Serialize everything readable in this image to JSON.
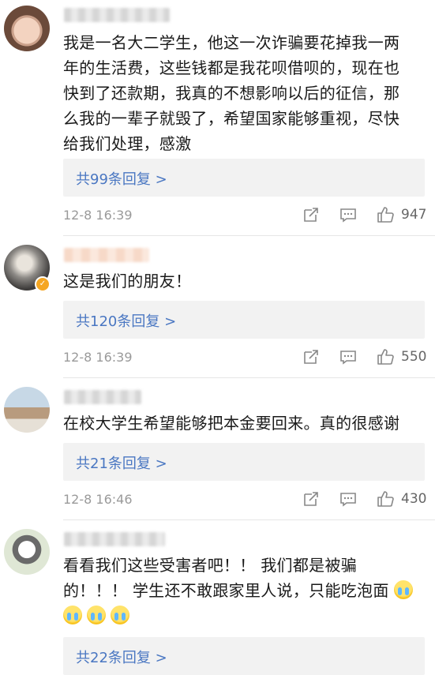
{
  "comments": [
    {
      "text_lines": [
        "我是一名大二学生，他这一次诈骗要花掉我一两",
        "年的生活费，这些钱都是我花呗借呗的，现在也",
        "快到了还款期，我真的不想影响以后的征信，那",
        "么我的一辈子就毁了，希望国家能够重视，尽快",
        "给我们处理，感激"
      ],
      "reply_label": "共99条回复 >",
      "time": "12-8 16:39",
      "likes": "947"
    },
    {
      "text_lines": [
        "这是我们的朋友！"
      ],
      "reply_label": "共120条回复 >",
      "time": "12-8 16:39",
      "likes": "550"
    },
    {
      "text_lines": [
        "在校大学生希望能够把本金要回来。真的很感谢"
      ],
      "reply_label": "共21条回复 >",
      "time": "12-8 16:46",
      "likes": "430"
    },
    {
      "text_lines": [
        "看看我们这些受害者吧！！ 我们都是被骗",
        "的！！！ 学生还不敢跟家里人说，只能吃泡面"
      ],
      "reply_label": "共22条回复 >"
    }
  ],
  "icons": [
    "forward-icon",
    "comment-icon",
    "thumb-up-icon",
    "crying-emoji"
  ],
  "colors": {
    "link": "#4a77c2",
    "meta": "#9a9a9a",
    "reply_bg": "#f2f2f2",
    "verified": "#f5a623"
  }
}
